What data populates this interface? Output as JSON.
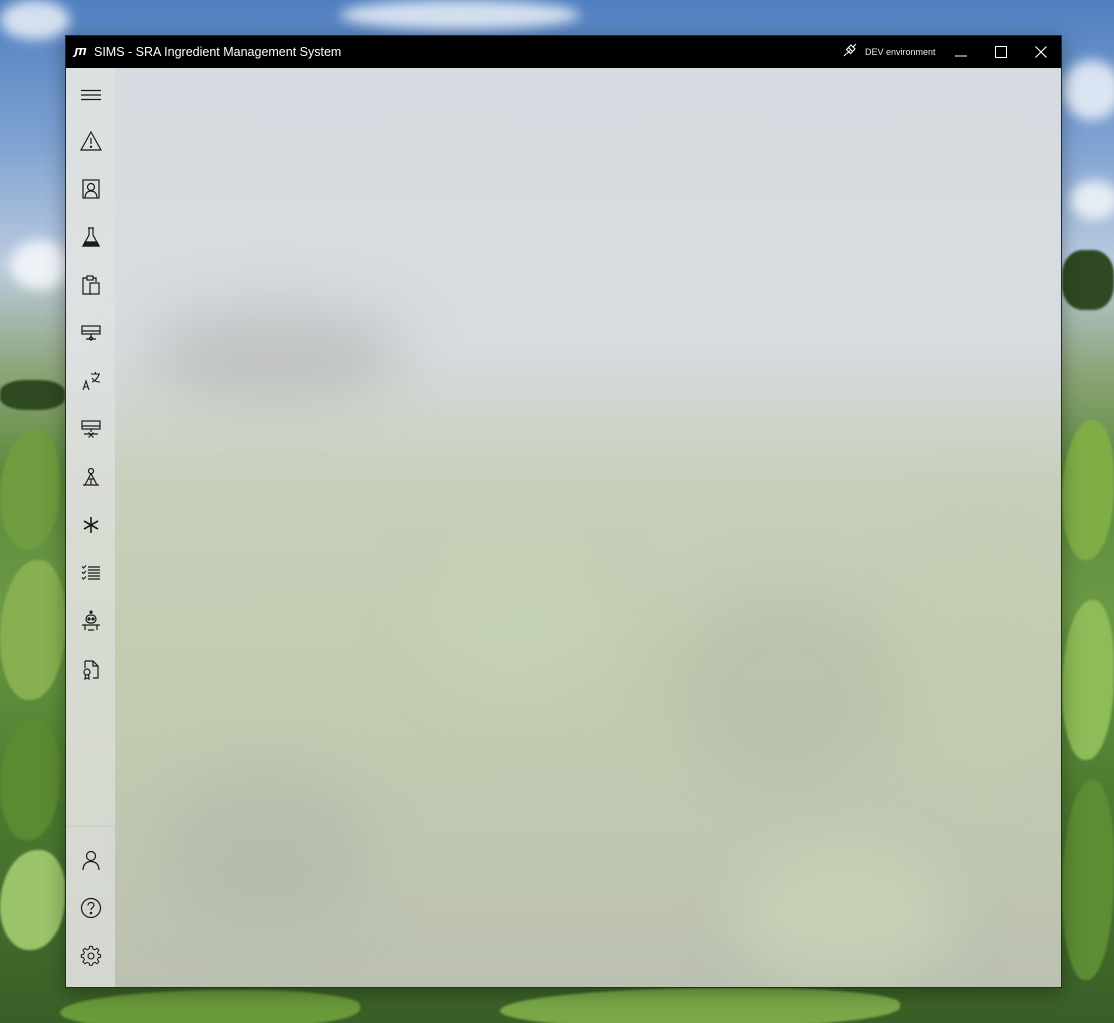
{
  "window": {
    "logo_text": "JTI",
    "title": "SIMS - SRA Ingredient Management System",
    "environment_label": "DEV environment",
    "controls": {
      "minimize_icon": "minimize-icon",
      "maximize_icon": "maximize-icon",
      "close_icon": "close-icon"
    }
  },
  "sidebar": {
    "top_items": [
      {
        "icon": "hamburger-menu-icon"
      },
      {
        "icon": "warning-icon"
      },
      {
        "icon": "contact-card-icon"
      },
      {
        "icon": "flask-icon"
      },
      {
        "icon": "clipboard-icon"
      },
      {
        "icon": "network-monitor-icon"
      },
      {
        "icon": "translate-icon"
      },
      {
        "icon": "network-remove-icon"
      },
      {
        "icon": "user-network-icon"
      },
      {
        "icon": "asterisk-icon"
      },
      {
        "icon": "checklist-icon"
      },
      {
        "icon": "robot-icon"
      },
      {
        "icon": "document-certificate-icon"
      }
    ],
    "bottom_items": [
      {
        "icon": "user-icon"
      },
      {
        "icon": "help-icon"
      },
      {
        "icon": "settings-icon"
      }
    ]
  },
  "colors": {
    "titlebar_bg": "#000000",
    "titlebar_text": "#ffffff",
    "icon_color": "#1a1a1a"
  }
}
